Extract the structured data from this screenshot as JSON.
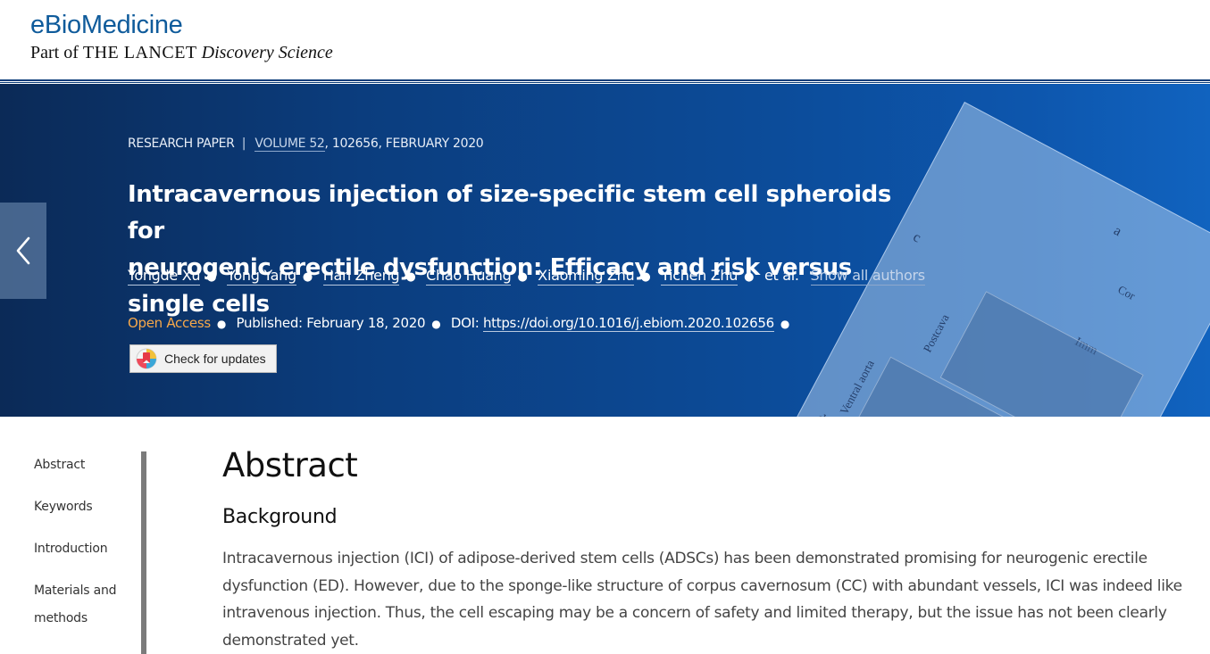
{
  "header": {
    "logo_title": "eBioMedicine",
    "logo_sub_prefix": "Part of",
    "logo_sub_lancet": "THE LANCET",
    "logo_sub_ds": "Discovery Science"
  },
  "banner": {
    "article_type": "RESEARCH PAPER",
    "separator": "|",
    "volume_link": "VOLUME 52",
    "volume_rest": ", 102656, FEBRUARY 2020",
    "title_line1": "Intracavernous injection of size-specific stem cell spheroids for",
    "title_line2": "neurogenic erectile dysfunction: Efficacy and risk versus single cells",
    "authors": [
      "Yongde Xu",
      "Yong Yang",
      "Han Zheng",
      "Chao Huang",
      "Xiaoming Zhu",
      "Yichen Zhu"
    ],
    "et_al": "et al.",
    "show_all": "Show all authors",
    "open_access": "Open Access",
    "published_label": "Published:",
    "published_date": "February 18, 2020",
    "doi_label": "DOI:",
    "doi": "https://doi.org/10.1016/j.ebiom.2020.102656",
    "check_updates": "Check for updates",
    "figure_labels": [
      "a",
      "c",
      "d",
      "Imm",
      "Postcava",
      "Ventral aorta",
      "Cor"
    ]
  },
  "toc": {
    "items": [
      "Abstract",
      "Keywords",
      "Introduction",
      "Materials and",
      "methods"
    ]
  },
  "content": {
    "heading": "Abstract",
    "subheading": "Background",
    "paragraph": "Intracavernous injection (ICI) of adipose-derived stem cells (ADSCs) has been demonstrated promising for neurogenic erectile dysfunction (ED). However, due to the sponge-like structure of corpus cavernosum (CC) with abundant vessels, ICI was indeed like intravenous injection. Thus, the cell escaping may be a concern of safety and limited therapy, but the issue has not been clearly demonstrated yet."
  },
  "colors": {
    "brand": "#0f5b9b",
    "banner_dark": "#0b2a57",
    "banner_light": "#1163bf",
    "open_access": "#f7a84a"
  },
  "icons": {
    "prev": "chevron-left-icon",
    "updates": "crossmark-icon"
  }
}
